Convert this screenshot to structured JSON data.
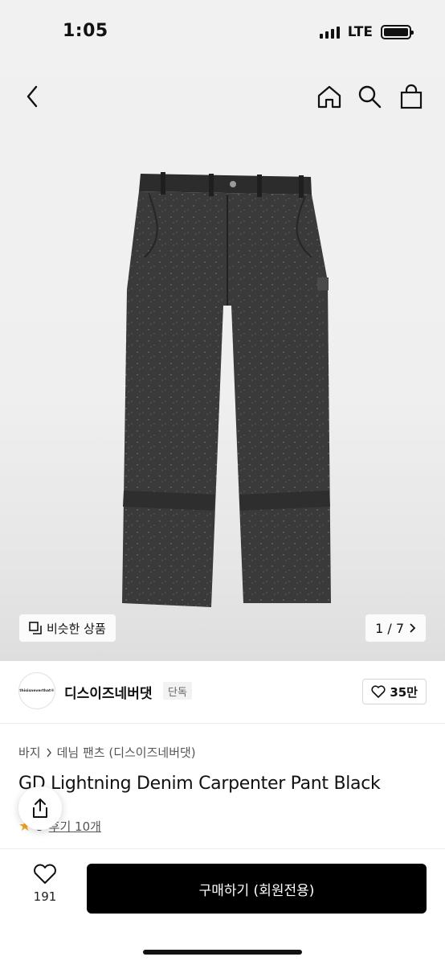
{
  "status": {
    "time": "1:05",
    "network": "LTE"
  },
  "nav": {
    "back": "back-icon",
    "home": "home-icon",
    "search": "search-icon",
    "bag": "shopping-bag-icon"
  },
  "gallery": {
    "similar_label": "비슷한 상품",
    "page_indicator": "1 / 7"
  },
  "brand": {
    "name": "디스이즈네버댓",
    "badge": "단독",
    "logo_text": "thisisneverthat®",
    "likes": "35만"
  },
  "breadcrumb": {
    "category": "바지",
    "subcategory": "데님 팬츠 (디스이즈네버댓)"
  },
  "product": {
    "title": "GD Lightning Denim Carpenter Pant Black",
    "rating": "5",
    "reviews": "후기 10개"
  },
  "bottom": {
    "wish_count": "191",
    "buy_label": "구매하기 (회원전용)"
  },
  "colors": {
    "accent": "#000000",
    "star": "#f5a623"
  }
}
